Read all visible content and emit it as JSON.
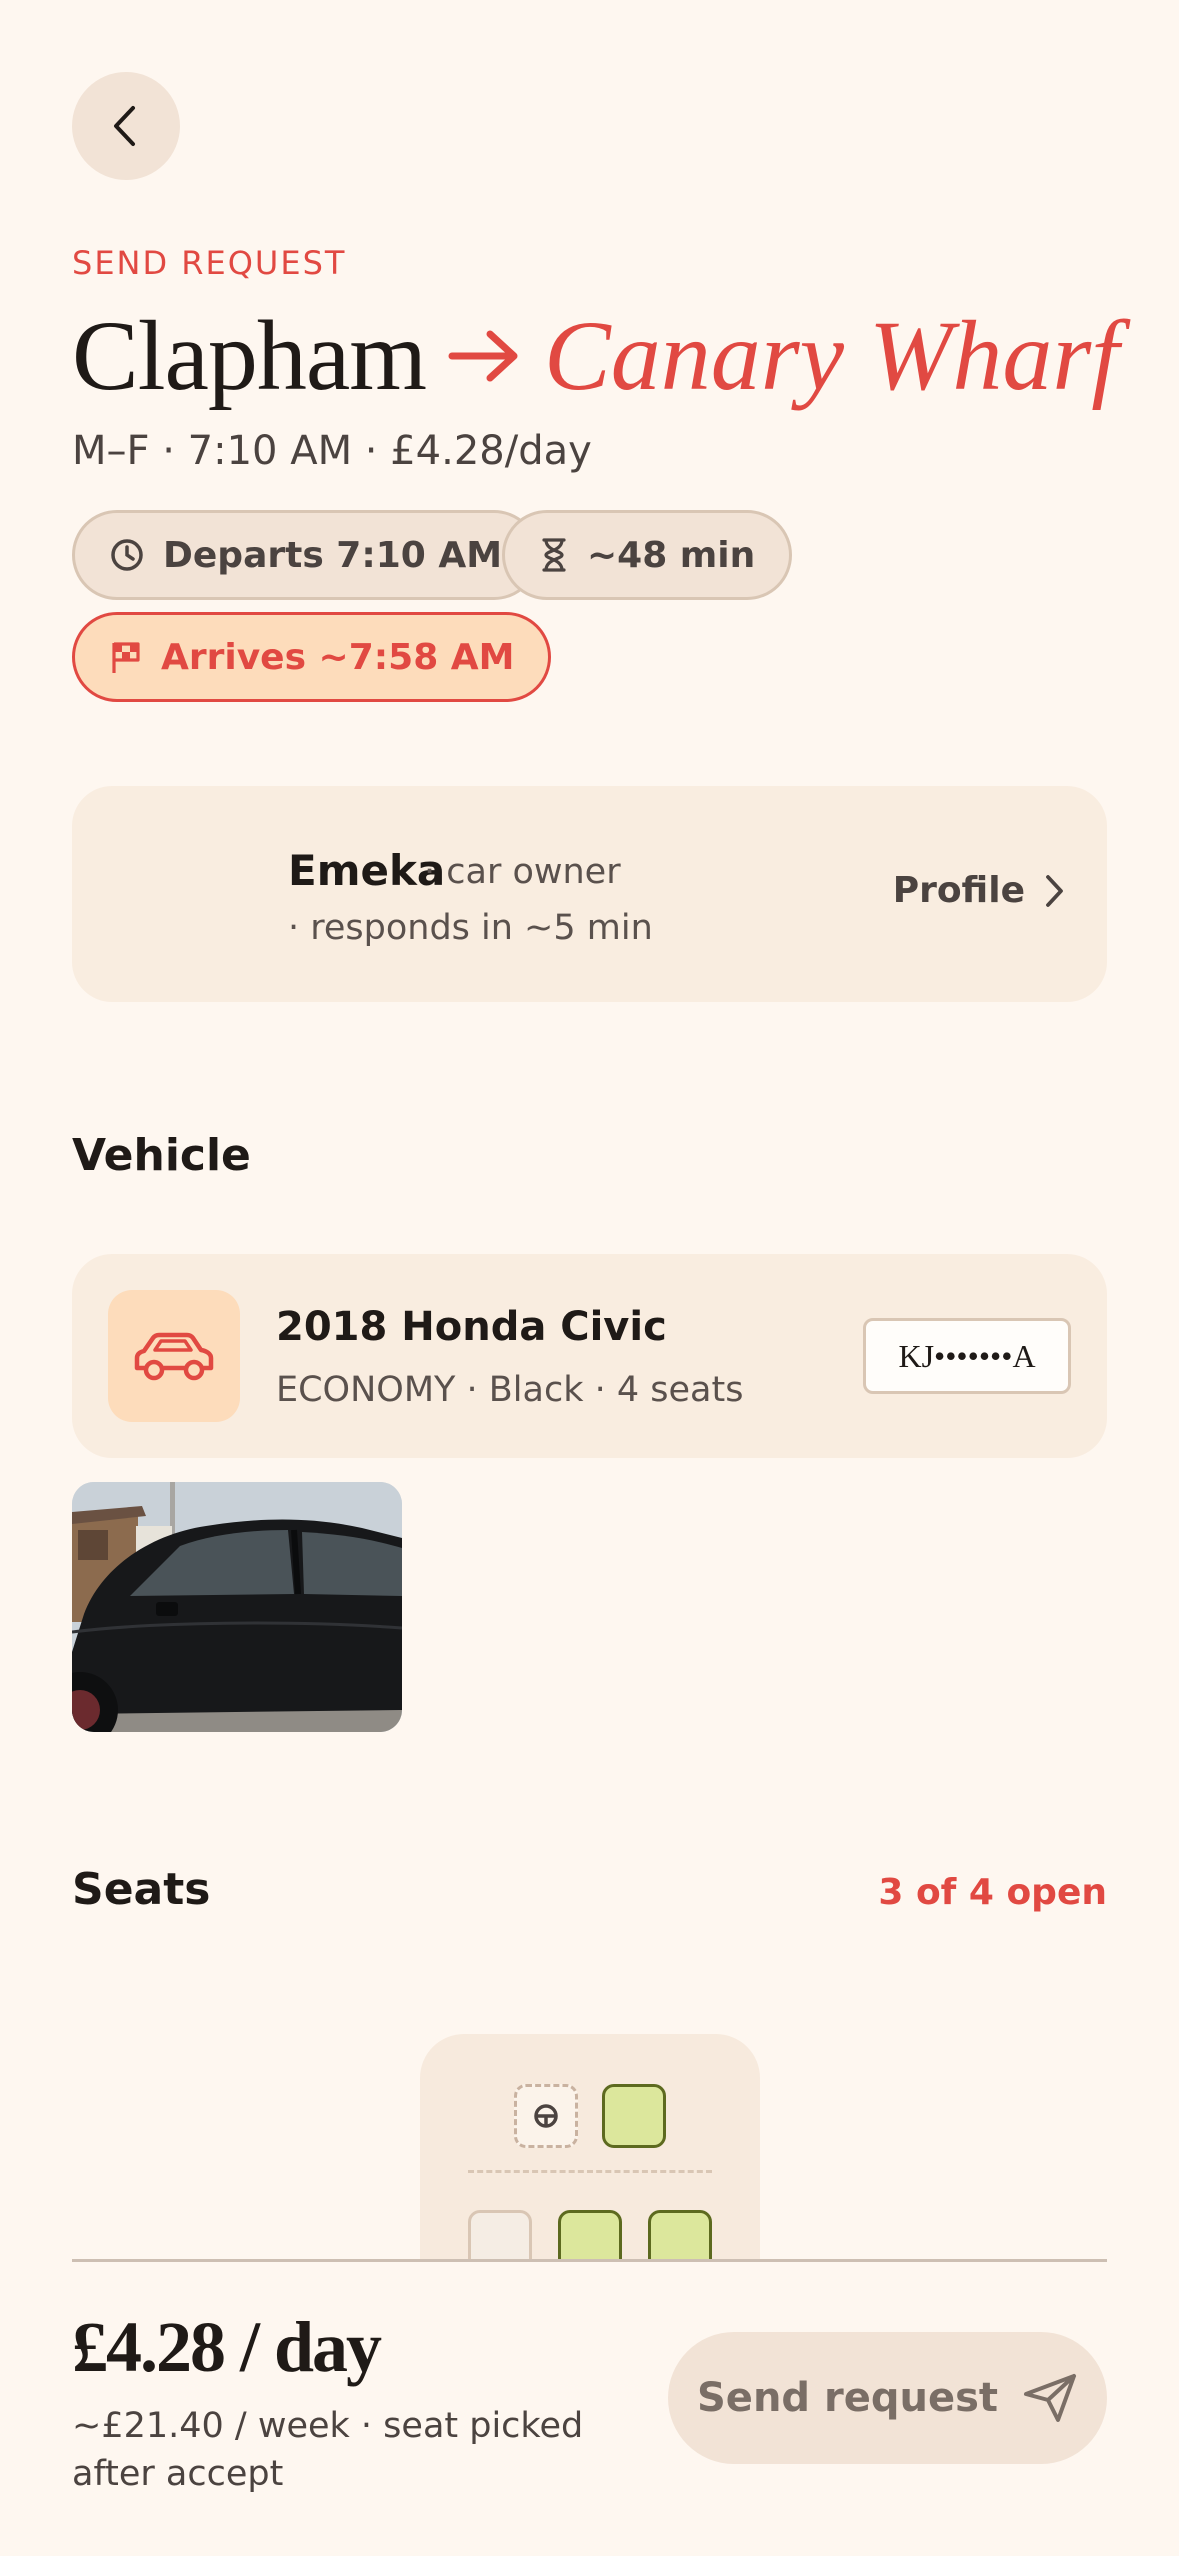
{
  "header": {
    "back_icon": "chevron-left-icon",
    "eyebrow": "SEND REQUEST",
    "origin": "Clapham",
    "destination": "Canary Wharf",
    "schedule": "M–F · 7:10 AM · £4.28/day"
  },
  "chips": [
    {
      "icon": "clock-icon",
      "label": "Departs 7:10 AM"
    },
    {
      "icon": "hourglass-icon",
      "label": "~48 min"
    },
    {
      "icon": "flag-icon",
      "label": "Arrives ~7:58 AM"
    }
  ],
  "driver": {
    "name": "Emeka",
    "role": "· car owner",
    "response": "· responds in ~5 min",
    "profile_label": "Profile"
  },
  "vehicle": {
    "section_title": "Vehicle",
    "name": "2018 Honda Civic",
    "meta": "ECONOMY · Black · 4 seats",
    "plate": "KJ•••••••A",
    "icon": "car-icon"
  },
  "seats": {
    "section_title": "Seats",
    "open_label": "3 of 4 open",
    "layout": [
      {
        "row": 1,
        "seats": [
          "driver",
          "open"
        ]
      },
      {
        "row": 2,
        "seats": [
          "taken",
          "open",
          "open"
        ]
      }
    ]
  },
  "footer": {
    "price": "£4.28 / day",
    "note": "~£21.40 / week · seat picked after accept",
    "send_label": "Send request",
    "send_icon": "send-icon"
  },
  "colors": {
    "background": "#FEF7F0",
    "accent": "#E14942",
    "card": "#F9EDE0",
    "seat_open": "#DCE79C"
  }
}
